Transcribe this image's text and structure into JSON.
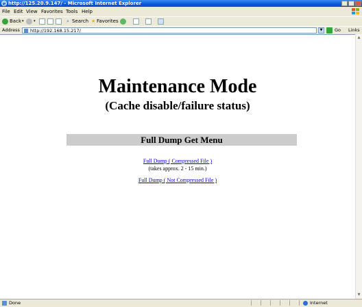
{
  "window": {
    "title": "http://125.20.9.147/ - Microsoft Internet Explorer"
  },
  "menu": [
    "File",
    "Edit",
    "View",
    "Favorites",
    "Tools",
    "Help"
  ],
  "toolbar": {
    "back_label": "Back",
    "search_label": "Search",
    "favorites_label": "Favorites"
  },
  "address": {
    "label": "Address",
    "url": "http://192.168.15.217/",
    "go_label": "Go",
    "links_label": "Links"
  },
  "page": {
    "title": "Maintenance Mode",
    "subtitle": "(Cache disable/failure status)",
    "menu_header": "Full Dump Get Menu",
    "link_compressed": "Full Dump ( Compressed File )",
    "note": "(takes approx. 2 - 15 min.)",
    "link_uncompressed": "Full Dump ( Not Compressed File )"
  },
  "status": {
    "text": "Done",
    "zone": "Internet"
  },
  "colors": {
    "titlebar": "#0a55d8",
    "chrome": "#ece9d8",
    "link": "#0000cc",
    "header_bg": "#cccccc"
  }
}
